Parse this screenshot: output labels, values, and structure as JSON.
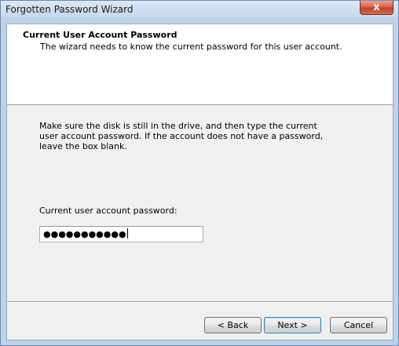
{
  "window": {
    "title": "Forgotten Password Wizard",
    "close_glyph": "x"
  },
  "header": {
    "title": "Current User Account Password",
    "subtitle": "The wizard needs to know the current password for this user account."
  },
  "body": {
    "instructions": "Make sure the disk is still in the drive, and then type the current user account password. If the account does not have a password, leave the box blank.",
    "password_label": "Current user account password:",
    "password_value": "●●●●●●●●●●●"
  },
  "buttons": {
    "back": "< Back",
    "next": "Next >",
    "cancel": "Cancel"
  },
  "colors": {
    "title_bar": "#c4d7ec",
    "close_button": "#c44227",
    "default_button_border": "#3c7fb1"
  }
}
